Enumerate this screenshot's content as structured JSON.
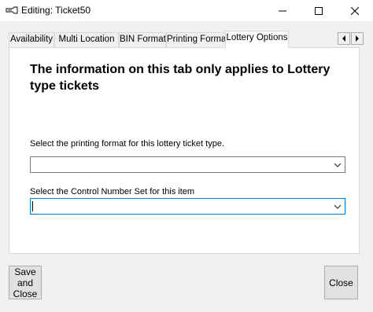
{
  "window": {
    "title": "Editing: Ticket50",
    "icon": "ticket-icon"
  },
  "tabs": [
    {
      "label": "Availability"
    },
    {
      "label": "Multi Location"
    },
    {
      "label": "BIN Format"
    },
    {
      "label": "Printing Format"
    },
    {
      "label": "Lottery Options",
      "active": true
    }
  ],
  "lottery": {
    "heading": "The information on this tab only applies to Lottery type tickets",
    "printing_format_label": "Select the printing format for this lottery ticket type.",
    "printing_format_value": "",
    "control_number_label": "Select the Control Number Set for this item",
    "control_number_value": ""
  },
  "buttons": {
    "save_close": "Save\nand\nClose",
    "close": "Close"
  }
}
